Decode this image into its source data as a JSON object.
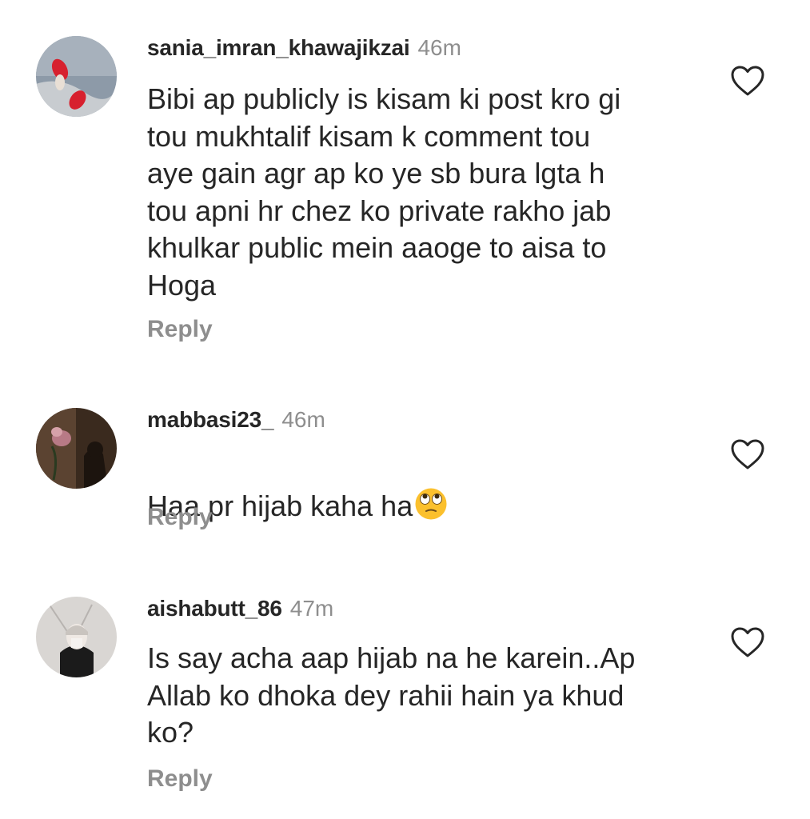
{
  "comments": [
    {
      "username": "sania_imran_khawajikzai",
      "time": "46m",
      "text": "Bibi ap publicly is kisam ki post kro gi\ntou mukhtalif kisam k comment tou\naye gain agr ap ko ye sb bura lgta h\ntou apni hr chez ko private rakho jab\nkhulkar public mein aaoge to aisa to\nHoga",
      "reply_label": "Reply",
      "like_icon": "heart-outline-icon"
    },
    {
      "username": "mabbasi23_",
      "time": "46m",
      "text": "Haa pr hijab kaha ha",
      "text_emoji": "face-with-rolling-eyes",
      "reply_label": "Reply",
      "like_icon": "heart-outline-icon"
    },
    {
      "username": "aishabutt_86",
      "time": "47m",
      "text": "Is say acha aap hijab na he karein..Ap\nAllab ko dhoka dey rahii hain ya khud\nko?",
      "reply_label": "Reply",
      "like_icon": "heart-outline-icon"
    }
  ],
  "colors": {
    "background": "#ffffff",
    "primary_text": "#262626",
    "secondary_text": "#8e8e8e",
    "emoji_yellow": "#fbc02d"
  }
}
